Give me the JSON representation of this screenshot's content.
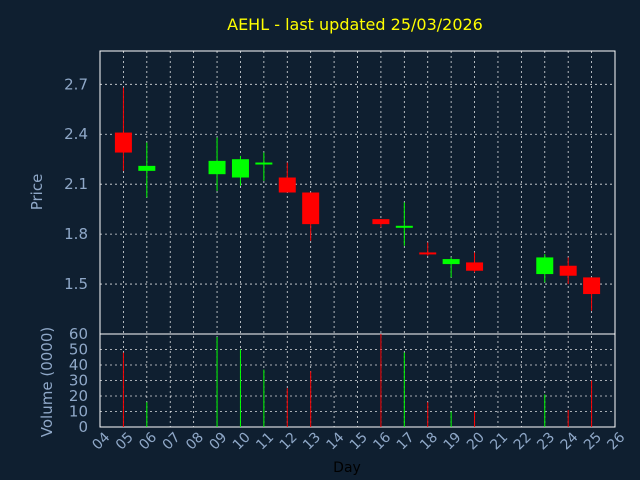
{
  "chart_data": {
    "type": "candlestick",
    "title": "AEHL - last updated 25/03/2026",
    "xlabel": "Day",
    "ylabel": "Price",
    "volume_label": "Volume (0000)",
    "x_ticks": [
      "04",
      "05",
      "06",
      "07",
      "08",
      "09",
      "10",
      "11",
      "12",
      "13",
      "14",
      "15",
      "16",
      "17",
      "18",
      "19",
      "20",
      "21",
      "22",
      "23",
      "24",
      "25",
      "26"
    ],
    "price_ticks": [
      "1.5",
      "1.8",
      "2.1",
      "2.4",
      "2.7"
    ],
    "volume_ticks": [
      "0",
      "10",
      "20",
      "30",
      "40",
      "50",
      "60"
    ],
    "price_range": [
      1.2,
      2.9
    ],
    "volume_range": [
      0,
      60
    ],
    "x_range": [
      4,
      26
    ],
    "grid": true,
    "colors": {
      "up": "#00ff00",
      "down": "#ff0000",
      "background": "#0f1f30",
      "title": "#ffff00",
      "axis_text": "#8fa8c8",
      "grid": "#ffffff"
    },
    "candles": [
      {
        "day": 5,
        "open": 2.41,
        "high": 2.68,
        "low": 2.18,
        "close": 2.29,
        "volume": 48
      },
      {
        "day": 6,
        "open": 2.18,
        "high": 2.35,
        "low": 2.02,
        "close": 2.21,
        "volume": 16
      },
      {
        "day": 9,
        "open": 2.16,
        "high": 2.38,
        "low": 2.06,
        "close": 2.24,
        "volume": 58
      },
      {
        "day": 10,
        "open": 2.14,
        "high": 2.27,
        "low": 2.09,
        "close": 2.25,
        "volume": 50
      },
      {
        "day": 11,
        "open": 2.22,
        "high": 2.29,
        "low": 2.12,
        "close": 2.23,
        "volume": 37
      },
      {
        "day": 12,
        "open": 2.14,
        "high": 2.23,
        "low": 2.05,
        "close": 2.05,
        "volume": 25
      },
      {
        "day": 13,
        "open": 2.05,
        "high": 2.05,
        "low": 1.76,
        "close": 1.86,
        "volume": 36
      },
      {
        "day": 16,
        "open": 1.89,
        "high": 1.89,
        "low": 1.84,
        "close": 1.86,
        "volume": 60
      },
      {
        "day": 17,
        "open": 1.84,
        "high": 1.99,
        "low": 1.73,
        "close": 1.85,
        "volume": 48
      },
      {
        "day": 18,
        "open": 1.69,
        "high": 1.75,
        "low": 1.67,
        "close": 1.68,
        "volume": 16
      },
      {
        "day": 19,
        "open": 1.62,
        "high": 1.66,
        "low": 1.54,
        "close": 1.65,
        "volume": 10
      },
      {
        "day": 20,
        "open": 1.63,
        "high": 1.69,
        "low": 1.57,
        "close": 1.58,
        "volume": 10
      },
      {
        "day": 23,
        "open": 1.56,
        "high": 1.68,
        "low": 1.51,
        "close": 1.66,
        "volume": 21
      },
      {
        "day": 24,
        "open": 1.61,
        "high": 1.66,
        "low": 1.5,
        "close": 1.55,
        "volume": 11
      },
      {
        "day": 25,
        "open": 1.54,
        "high": 1.54,
        "low": 1.34,
        "close": 1.44,
        "volume": 30
      }
    ]
  }
}
